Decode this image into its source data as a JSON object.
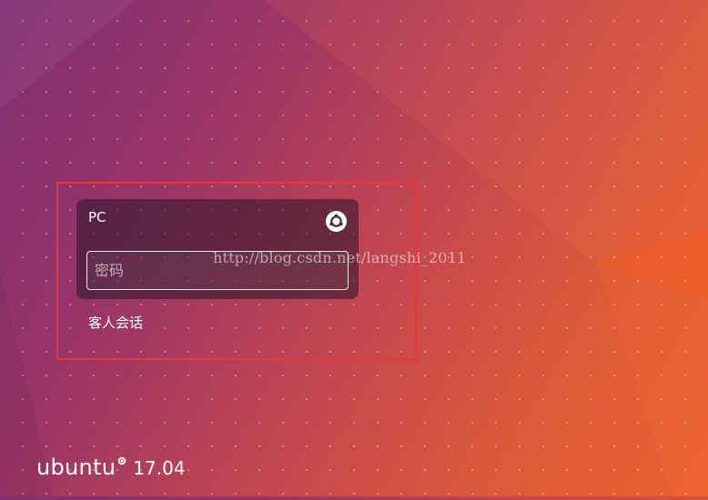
{
  "login": {
    "user_name": "PC",
    "password_placeholder": "密码",
    "session_icon": "ubuntu-session-icon",
    "guest_session_label": "客人会话"
  },
  "watermark": {
    "text": "http://blog.csdn.net/langshi_2011"
  },
  "brand": {
    "logo_text": "ubuntu",
    "version": "17.04"
  },
  "colors": {
    "highlight": "#e8383b",
    "background_start": "#7e2f72",
    "background_end": "#e8622f"
  }
}
